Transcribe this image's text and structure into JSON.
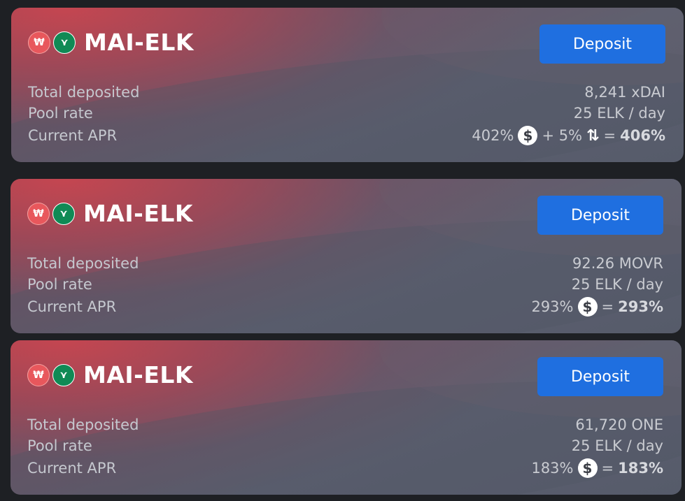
{
  "cards": [
    {
      "pair": "MAI-ELK",
      "deposit_label": "Deposit",
      "total_deposited_label": "Total deposited",
      "total_deposited": "8,241 xDAI",
      "pool_rate_label": "Pool rate",
      "pool_rate": "25 ELK / day",
      "apr_label": "Current APR",
      "apr_reward": "402%",
      "apr_plus": "+ 5%",
      "apr_eq": "=",
      "apr_total": "406%"
    },
    {
      "pair": "MAI-ELK",
      "deposit_label": "Deposit",
      "total_deposited_label": "Total deposited",
      "total_deposited": "92.26 MOVR",
      "pool_rate_label": "Pool rate",
      "pool_rate": "25 ELK / day",
      "apr_label": "Current APR",
      "apr_reward": "293%",
      "apr_eq": "=",
      "apr_total": "293%"
    },
    {
      "pair": "MAI-ELK",
      "deposit_label": "Deposit",
      "total_deposited_label": "Total deposited",
      "total_deposited": "61,720 ONE",
      "pool_rate_label": "Pool rate",
      "pool_rate": "25 ELK / day",
      "apr_label": "Current APR",
      "apr_reward": "183%",
      "apr_eq": "=",
      "apr_total": "183%"
    }
  ],
  "icons": {
    "token_a": "mai-token-icon",
    "token_b": "elk-token-icon",
    "reward": "dollar-coin-icon",
    "swap": "swap-fee-icon"
  },
  "colors": {
    "deposit_button": "#1f6fe0",
    "mai_token": "#e8575c",
    "elk_token": "#108a55"
  }
}
